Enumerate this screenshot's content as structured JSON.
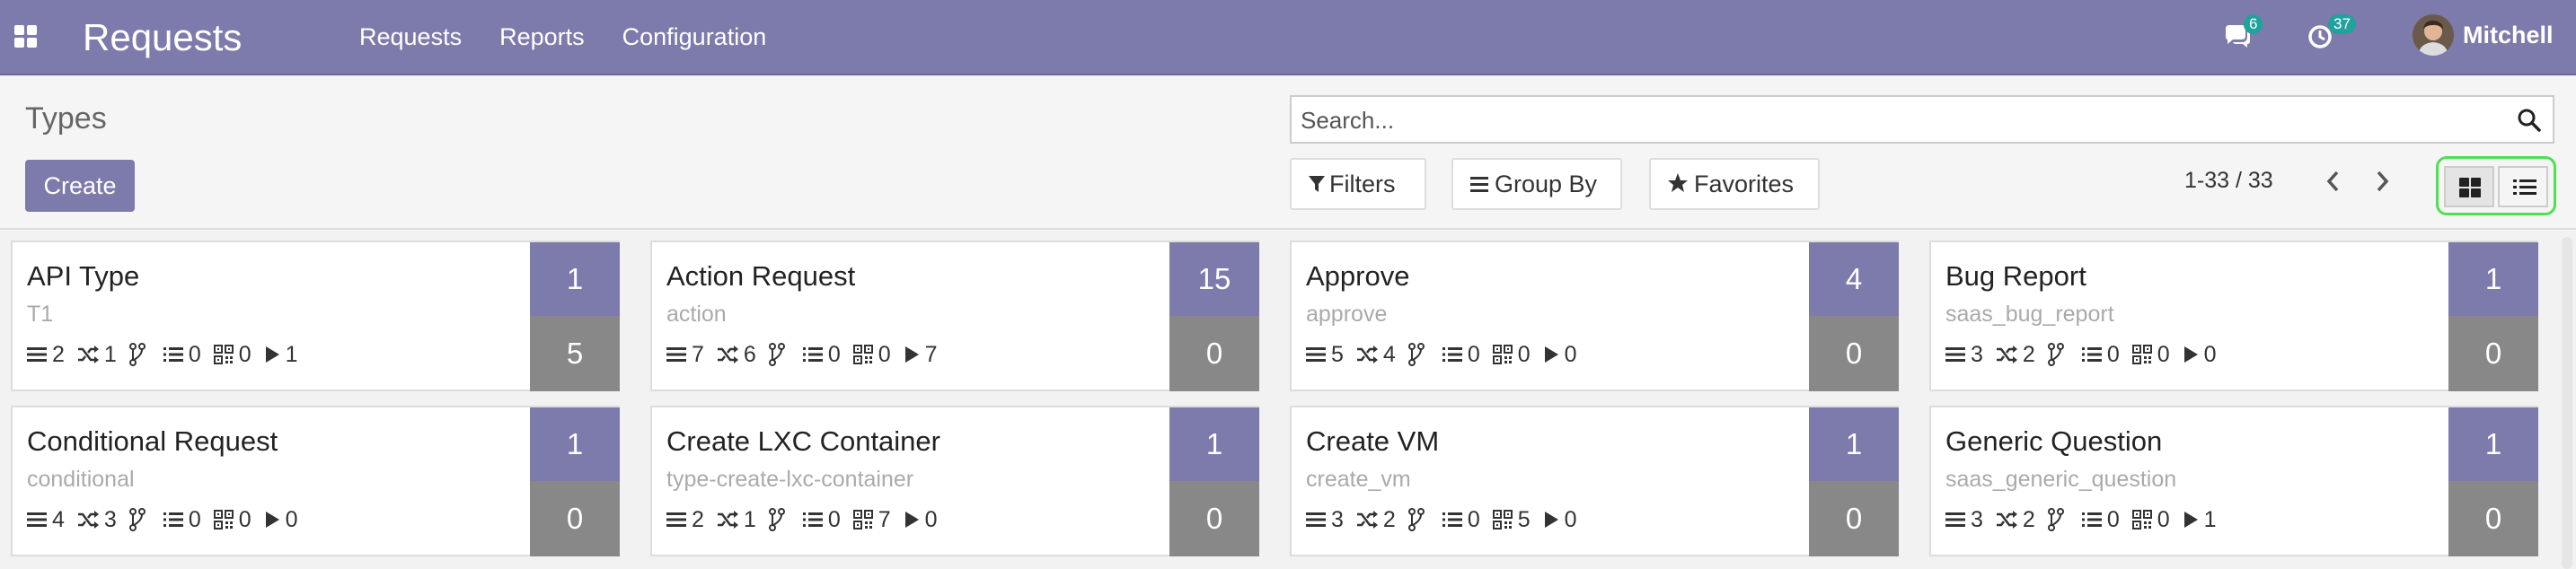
{
  "navbar": {
    "brand": "Requests",
    "menu": [
      "Requests",
      "Reports",
      "Configuration"
    ],
    "messages_count": "6",
    "activities_count": "37",
    "user_name": "Mitchell"
  },
  "control": {
    "title": "Types",
    "create_label": "Create",
    "search_placeholder": "Search...",
    "filters_label": "Filters",
    "groupby_label": "Group By",
    "favorites_label": "Favorites",
    "pager": "1-33 / 33"
  },
  "colors": {
    "navbar": "#7d7bab",
    "stat_top": "#7d7bab",
    "stat_bottom": "#888888",
    "badge": "#1fa39a",
    "highlight": "#4fe04f"
  },
  "cards": [
    {
      "name": "API Type",
      "code": "T1",
      "stats": [
        "2",
        "1",
        "",
        "0",
        "0",
        "1"
      ],
      "top": "1",
      "bottom": "5"
    },
    {
      "name": "Action Request",
      "code": "action",
      "stats": [
        "7",
        "6",
        "",
        "0",
        "0",
        "7"
      ],
      "top": "15",
      "bottom": "0"
    },
    {
      "name": "Approve",
      "code": "approve",
      "stats": [
        "5",
        "4",
        "",
        "0",
        "0",
        "0"
      ],
      "top": "4",
      "bottom": "0"
    },
    {
      "name": "Bug Report",
      "code": "saas_bug_report",
      "stats": [
        "3",
        "2",
        "",
        "0",
        "0",
        "0"
      ],
      "top": "1",
      "bottom": "0"
    },
    {
      "name": "Conditional Request",
      "code": "conditional",
      "stats": [
        "4",
        "3",
        "",
        "0",
        "0",
        "0"
      ],
      "top": "1",
      "bottom": "0"
    },
    {
      "name": "Create LXC Container",
      "code": "type-create-lxc-container",
      "stats": [
        "2",
        "1",
        "",
        "0",
        "7",
        "0"
      ],
      "top": "1",
      "bottom": "0"
    },
    {
      "name": "Create VM",
      "code": "create_vm",
      "stats": [
        "3",
        "2",
        "",
        "0",
        "5",
        "0"
      ],
      "top": "1",
      "bottom": "0"
    },
    {
      "name": "Generic Question",
      "code": "saas_generic_question",
      "stats": [
        "3",
        "2",
        "",
        "0",
        "0",
        "1"
      ],
      "top": "1",
      "bottom": "0"
    }
  ]
}
